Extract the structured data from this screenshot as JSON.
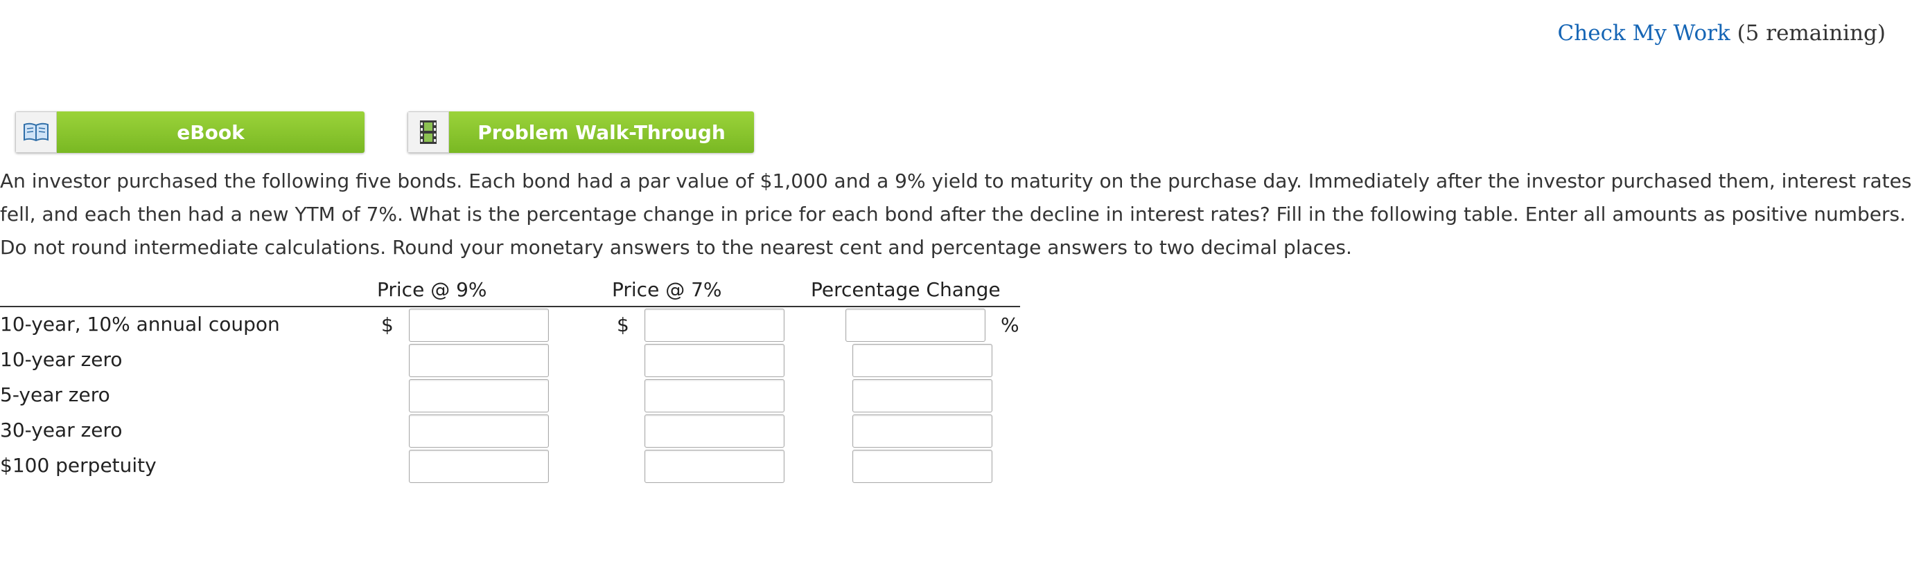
{
  "header": {
    "check_label": "Check My Work",
    "remaining": "(5 remaining)"
  },
  "resources": [
    {
      "label": "eBook",
      "icon": "book-icon"
    },
    {
      "label": "Problem Walk-Through",
      "icon": "film-icon"
    }
  ],
  "question": "An investor purchased the following five bonds. Each bond had a par value of $1,000 and a 9% yield to maturity on the purchase day. Immediately after the investor purchased them, interest rates fell, and each then had a new YTM of 7%. What is the percentage change in price for each bond after the decline in interest rates? Fill in the following table. Enter all amounts as positive numbers. Do not round intermediate calculations. Round your monetary answers to the nearest cent and percentage answers to two decimal places.",
  "table": {
    "columns": [
      "Price @ 9%",
      "Price @ 7%",
      "Percentage Change"
    ],
    "rows": [
      {
        "label": "10-year, 10% annual coupon",
        "price9": "",
        "price7": "",
        "pct": ""
      },
      {
        "label": "10-year zero",
        "price9": "",
        "price7": "",
        "pct": ""
      },
      {
        "label": "5-year zero",
        "price9": "",
        "price7": "",
        "pct": ""
      },
      {
        "label": "30-year zero",
        "price9": "",
        "price7": "",
        "pct": ""
      },
      {
        "label": "$100 perpetuity",
        "price9": "",
        "price7": "",
        "pct": ""
      }
    ],
    "currency_symbol": "$",
    "percent_symbol": "%"
  }
}
